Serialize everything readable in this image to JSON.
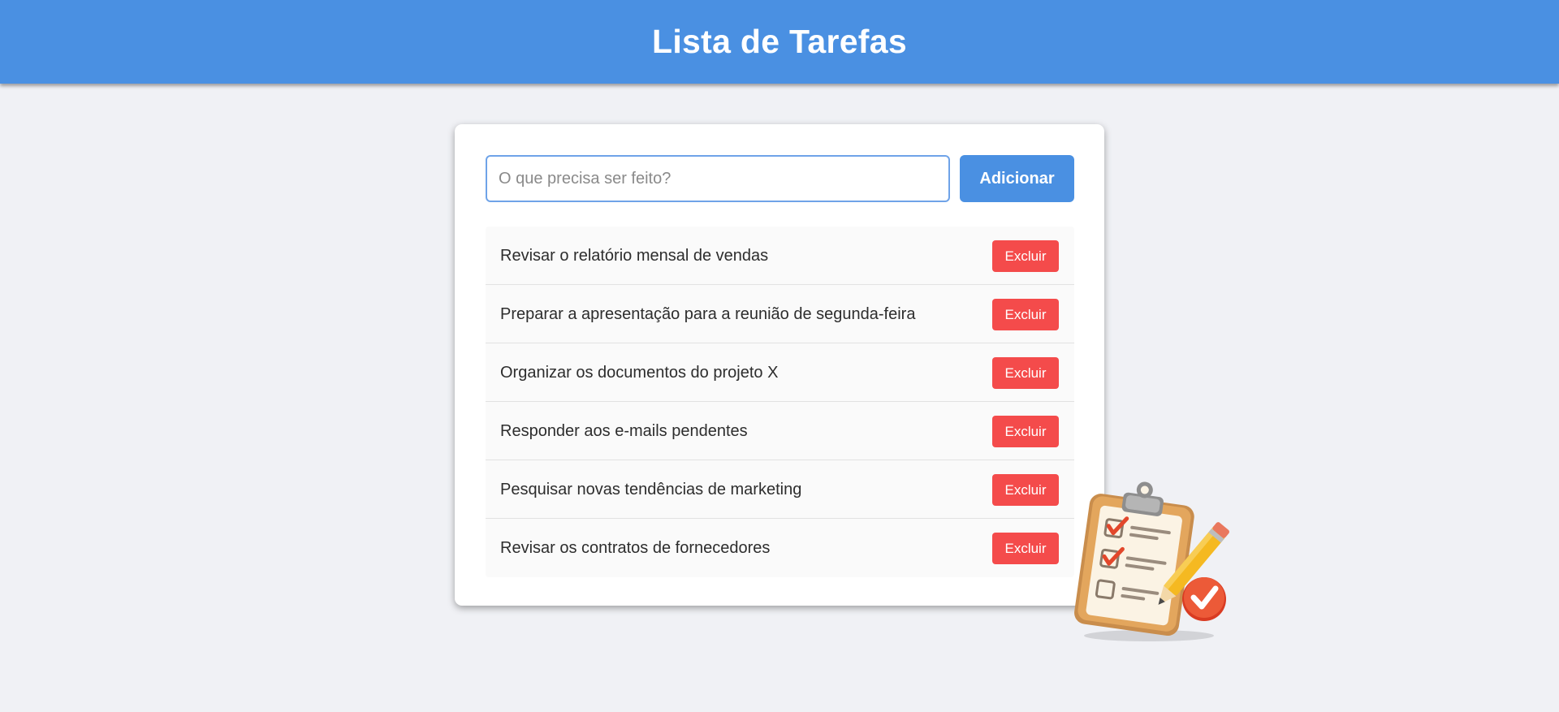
{
  "header": {
    "title": "Lista de Tarefas"
  },
  "form": {
    "input_placeholder": "O que precisa ser feito?",
    "input_value": "",
    "add_label": "Adicionar"
  },
  "tasks": [
    {
      "text": "Revisar o relatório mensal de vendas",
      "delete_label": "Excluir"
    },
    {
      "text": "Preparar a apresentação para a reunião de segunda-feira",
      "delete_label": "Excluir"
    },
    {
      "text": "Organizar os documentos do projeto X",
      "delete_label": "Excluir"
    },
    {
      "text": "Responder aos e-mails pendentes",
      "delete_label": "Excluir"
    },
    {
      "text": "Pesquisar novas tendências de marketing",
      "delete_label": "Excluir"
    },
    {
      "text": "Revisar os contratos de fornecedores",
      "delete_label": "Excluir"
    }
  ],
  "colors": {
    "header": "#4a90e2",
    "primary": "#4a90e2",
    "danger": "#f44b4b",
    "background": "#f0f1f5"
  },
  "illustration": {
    "icon": "clipboard-checklist-icon"
  }
}
